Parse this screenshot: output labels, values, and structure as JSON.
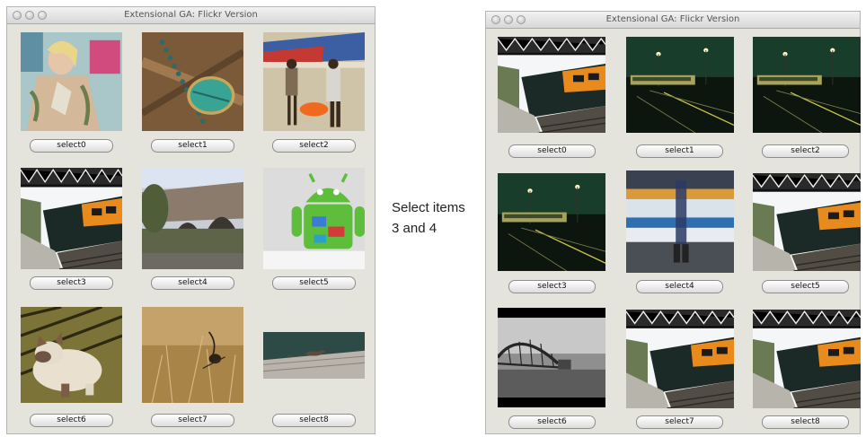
{
  "left_window": {
    "title": "Extensional GA: Flickr Version",
    "cells": [
      {
        "image": "woman-with-tattoos-photo",
        "button": "select0"
      },
      {
        "image": "beaded-necklace-photo",
        "button": "select1"
      },
      {
        "image": "beach-boats-photo",
        "button": "select2"
      },
      {
        "image": "train-at-platform-photo",
        "button": "select3"
      },
      {
        "image": "stone-bridge-photo",
        "button": "select4"
      },
      {
        "image": "android-figure-photo",
        "button": "select5"
      },
      {
        "image": "cat-photo",
        "button": "select6"
      },
      {
        "image": "dry-grass-plant-photo",
        "button": "select7"
      },
      {
        "image": "mouse-on-log-photo",
        "button": "select8"
      }
    ]
  },
  "annotation": {
    "line1": "Select items",
    "line2": "3 and 4"
  },
  "right_window": {
    "title": "Extensional GA: Flickr Version",
    "cells": [
      {
        "image": "train-at-platform-photo",
        "button": "select0"
      },
      {
        "image": "night-rail-yard-photo",
        "button": "select1"
      },
      {
        "image": "night-rail-yard-photo",
        "button": "select2"
      },
      {
        "image": "night-rail-yard-photo",
        "button": "select3"
      },
      {
        "image": "motion-blur-subway-photo",
        "button": "select4"
      },
      {
        "image": "train-at-platform-photo",
        "button": "select5"
      },
      {
        "image": "bw-pier-bridge-photo",
        "button": "select6"
      },
      {
        "image": "train-at-platform-photo",
        "button": "select7"
      },
      {
        "image": "train-at-platform-photo",
        "button": "select8"
      }
    ]
  }
}
